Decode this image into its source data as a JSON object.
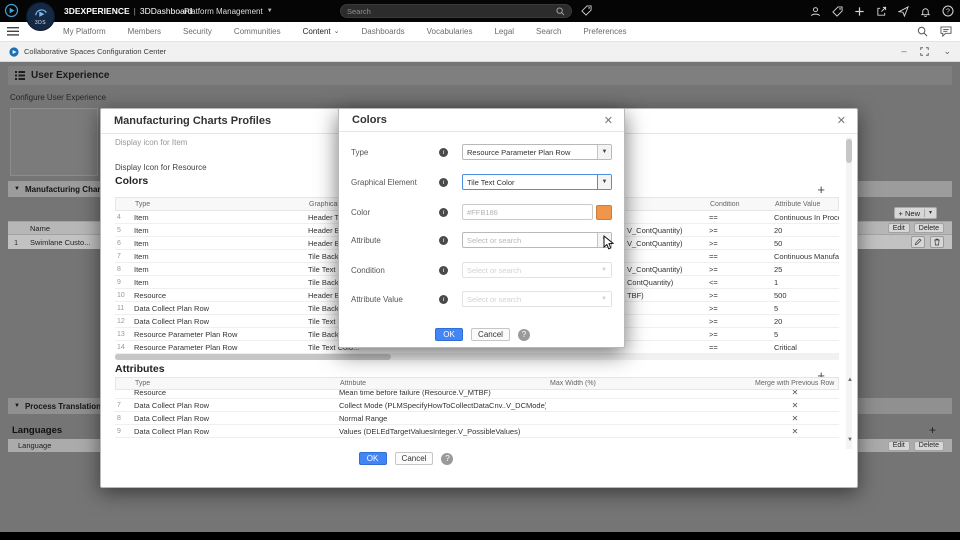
{
  "theme": {
    "accent_blue": "#4285F4",
    "swatch_orange": "#F0964B"
  },
  "icons": {
    "triangle_down": "▼",
    "chevron_down": "⌄",
    "caret_down": "▾",
    "minimize": "–",
    "plus": "+",
    "close": "✕",
    "info": "i",
    "help": "?"
  },
  "topbar": {
    "brand": "3DEXPERIENCE",
    "divider": "|",
    "app": "3DDashboard",
    "context_menu": "Platform Management",
    "search_placeholder": "Search",
    "badge_text": "3DS"
  },
  "nav": {
    "tabs": [
      "My Platform",
      "Members",
      "Security",
      "Communities",
      "Content",
      "Dashboards",
      "Vocabularies",
      "Legal",
      "Search",
      "Preferences"
    ],
    "active_tab": "Content"
  },
  "appbar": {
    "title": "Collaborative Spaces Configuration Center"
  },
  "workspace": {
    "widget_title": "User Experience",
    "subtitle": "Configure User Experience",
    "manufacturing_section": "Manufacturing Chart",
    "process_translation_section": "Process Translation",
    "new_button": "+ New",
    "edit_button": "Edit",
    "delete_button": "Delete",
    "name_column": "Name",
    "row_index": "1",
    "row_name": "Swimlane Custo...",
    "languages_heading": "Languages",
    "language_column": "Language"
  },
  "profiles_dialog": {
    "title": "Manufacturing Charts Profiles",
    "display_icon_item": "Display icon for Item",
    "display_icon_resource": "Display Icon for Resource",
    "colors_heading": "Colors",
    "attributes_heading": "Attributes",
    "ok_button": "OK",
    "cancel_button": "Cancel",
    "colors_table": {
      "headers": {
        "num": "",
        "type": "Type",
        "graphical": "Graphical Element",
        "attribute": "",
        "condition": "Condition",
        "value": "Attribute Value"
      },
      "rows": [
        {
          "n": "4",
          "type": "Item",
          "graphical": "Header Text C...",
          "attr_tail": "",
          "cond": "==",
          "value": "Continuous In Process Item"
        },
        {
          "n": "5",
          "type": "Item",
          "graphical": "Header Backg...",
          "attr_tail": "V_ContQuantity)",
          "cond": ">=",
          "value": "20"
        },
        {
          "n": "6",
          "type": "Item",
          "graphical": "Header Backg...",
          "attr_tail": "V_ContQuantity)",
          "cond": ">=",
          "value": "50"
        },
        {
          "n": "7",
          "type": "Item",
          "graphical": "Tile Backgrou...",
          "attr_tail": "",
          "cond": "==",
          "value": "Continuous Manufactured Material"
        },
        {
          "n": "8",
          "type": "Item",
          "graphical": "Tile Text Colo...",
          "attr_tail": "V_ContQuantity)",
          "cond": ">=",
          "value": "25"
        },
        {
          "n": "9",
          "type": "Item",
          "graphical": "Tile Backgrou...",
          "attr_tail": "ContQuantity)",
          "cond": "<=",
          "value": "1"
        },
        {
          "n": "10",
          "type": "Resource",
          "graphical": "Header Backg...",
          "attr_tail": "TBF)",
          "cond": ">=",
          "value": "500"
        },
        {
          "n": "11",
          "type": "Data Collect Plan Row",
          "graphical": "Tile Backgrou...",
          "attr_tail": "",
          "cond": ">=",
          "value": "5"
        },
        {
          "n": "12",
          "type": "Data Collect Plan Row",
          "graphical": "Tile Text Colo...",
          "attr_tail": "",
          "cond": ">=",
          "value": "20"
        },
        {
          "n": "13",
          "type": "Resource Parameter Plan Row",
          "graphical": "Tile Backgrou...",
          "attr_tail": "",
          "cond": ">=",
          "value": "5"
        },
        {
          "n": "14",
          "type": "Resource Parameter Plan Row",
          "graphical": "Tile Text Colo...",
          "attr_tail": "",
          "cond": "==",
          "value": "Critical"
        }
      ]
    },
    "attributes_table": {
      "headers": {
        "num": "",
        "type": "Type",
        "attribute": "Attribute",
        "max_width": "Max Width (%)",
        "merge": "Merge with Previous Row"
      },
      "rows": [
        {
          "n": "",
          "type": "Resource",
          "attribute": "Mean time before failure (Resource.V_MTBF)",
          "max_width": "",
          "merge": "✕",
          "clipped": true
        },
        {
          "n": "7",
          "type": "Data Collect Plan Row",
          "attribute": "Collect Mode (PLMSpecifyHowToCollectDataCnv..V_DCMode)",
          "max_width": "",
          "merge": "✕",
          "clipped": false
        },
        {
          "n": "8",
          "type": "Data Collect Plan Row",
          "attribute": "Normal Range",
          "max_width": "",
          "merge": "✕",
          "clipped": false
        },
        {
          "n": "9",
          "type": "Data Collect Plan Row",
          "attribute": "Values (DELEdTargetValuesInteger.V_PossibleValues)",
          "max_width": "",
          "merge": "✕",
          "clipped": false
        }
      ]
    }
  },
  "colors_dialog": {
    "title": "Colors",
    "fields": {
      "type": {
        "label": "Type",
        "value": "Resource Parameter Plan Row"
      },
      "graphical_element": {
        "label": "Graphical Element",
        "value": "Tile Text Color"
      },
      "color": {
        "label": "Color",
        "value": "#FFB186"
      },
      "attribute": {
        "label": "Attribute",
        "placeholder": "Select or search"
      },
      "condition": {
        "label": "Condition",
        "placeholder": "Select or search"
      },
      "attribute_value": {
        "label": "Attribute Value",
        "placeholder": "Select or search"
      }
    },
    "ok_button": "OK",
    "cancel_button": "Cancel"
  }
}
